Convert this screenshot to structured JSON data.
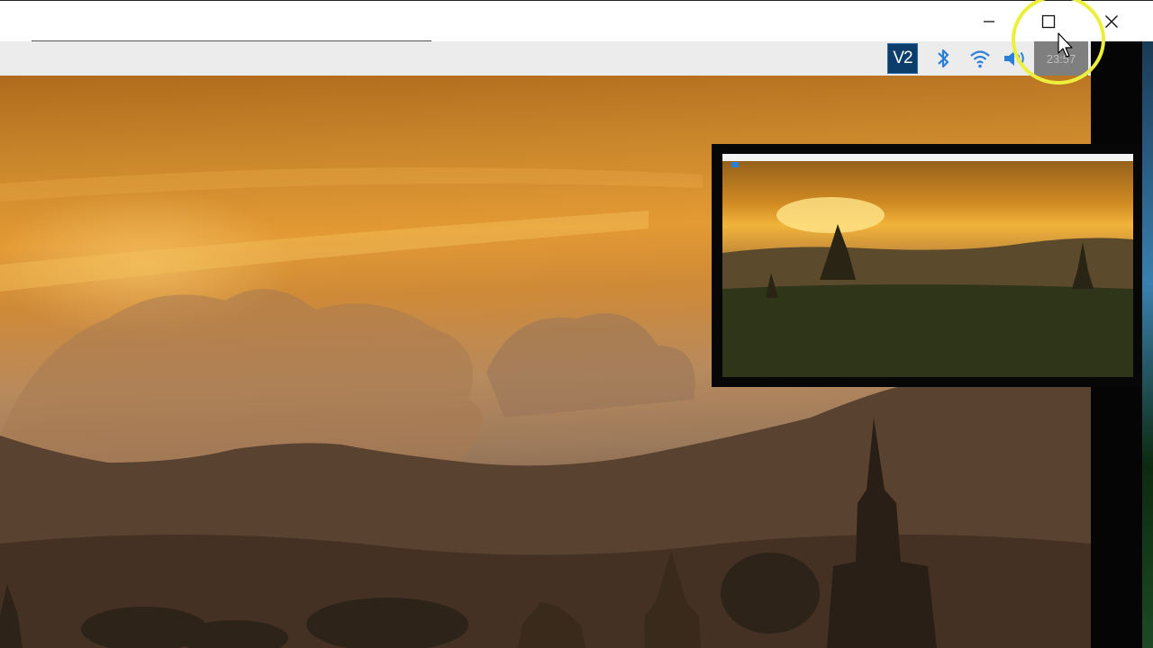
{
  "window": {
    "controls": {
      "minimize_icon": "minimize-icon",
      "maximize_icon": "maximize-icon",
      "close_icon": "close-icon"
    }
  },
  "panel": {
    "tray": {
      "vnc_label": "V2",
      "bluetooth_icon": "bluetooth-icon",
      "wifi_icon": "wifi-icon",
      "volume_icon": "volume-icon",
      "clock": "23:57"
    }
  },
  "colors": {
    "titlebar": "#ffffff",
    "panel": "#ececec",
    "vnc_badge": "#0c3d6b",
    "tray_blue": "#2a7fd6",
    "highlight_ring": "#ecef3c"
  }
}
